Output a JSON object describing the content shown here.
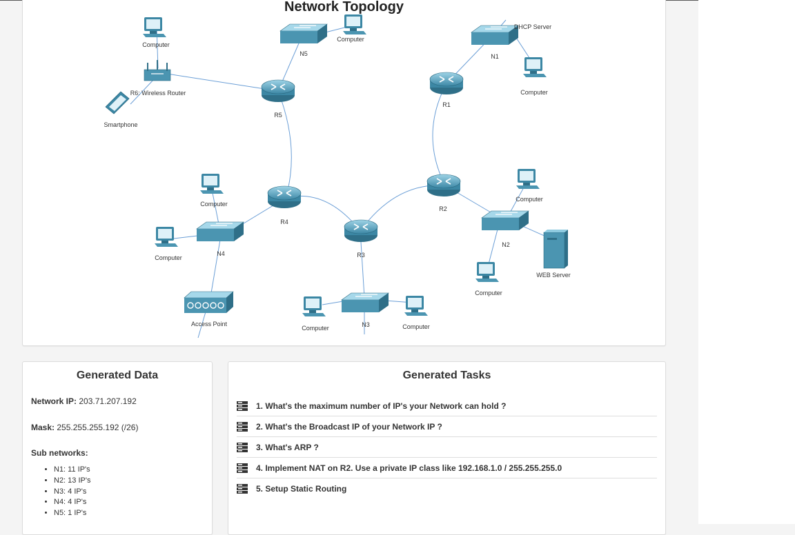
{
  "topology": {
    "title": "Network Topology",
    "labels": {
      "computer": "Computer",
      "r6": "R6: Wireless Router",
      "smartphone": "Smartphone",
      "n5": "N5",
      "r5": "R5",
      "dhcp": "DHCP Server",
      "n1": "N1",
      "r1": "R1",
      "r4": "R4",
      "r2": "R2",
      "r3": "R3",
      "n4": "N4",
      "n2": "N2",
      "n3": "N3",
      "web": "WEB Server",
      "ap": "Access Point"
    },
    "colors": {
      "link": "#6a9ed6",
      "device": "#4f97b3",
      "device_dark": "#2f6f88"
    }
  },
  "data": {
    "title": "Generated Data",
    "network_ip_label": "Network IP:",
    "network_ip_value": "203.71.207.192",
    "mask_label": "Mask:",
    "mask_value": "255.255.255.192 (/26)",
    "subnets_title": "Sub networks:",
    "subnets": [
      "N1: 11 IP's",
      "N2: 13 IP's",
      "N3: 4 IP's",
      "N4: 4 IP's",
      "N5: 1 IP's"
    ]
  },
  "tasks": {
    "title": "Generated Tasks",
    "icon": "server-icon",
    "items": [
      "1. What's the maximum number of IP's your Network can hold ?",
      "2. What's the Broadcast IP of your Network IP ?",
      "3. What's ARP ?",
      "4. Implement NAT on R2. Use a private IP class like 192.168.1.0 / 255.255.255.0",
      "5. Setup Static Routing"
    ]
  }
}
